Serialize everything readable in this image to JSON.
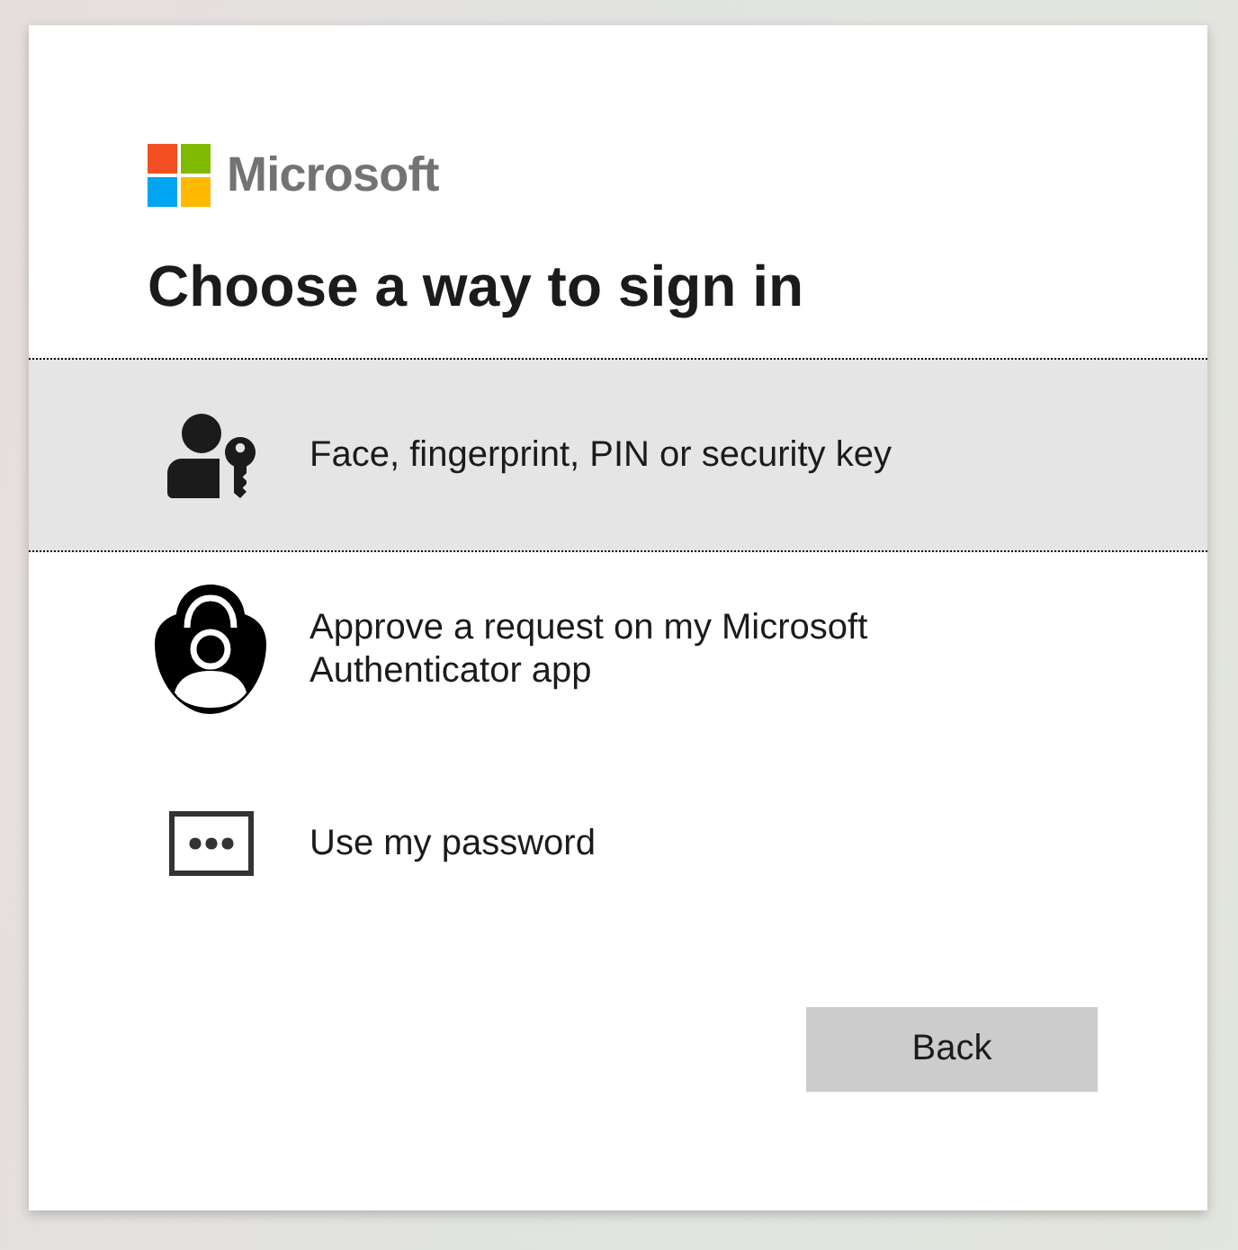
{
  "logo": {
    "text": "Microsoft"
  },
  "title": "Choose a way to sign in",
  "options": [
    {
      "kind": "passkey",
      "label": "Face, fingerprint, PIN or security key",
      "selected": true
    },
    {
      "kind": "authenticator",
      "label": "Approve a request on my Microsoft Authenticator app",
      "selected": false
    },
    {
      "kind": "password",
      "label": "Use my password",
      "selected": false
    }
  ],
  "back_button": {
    "label": "Back"
  }
}
